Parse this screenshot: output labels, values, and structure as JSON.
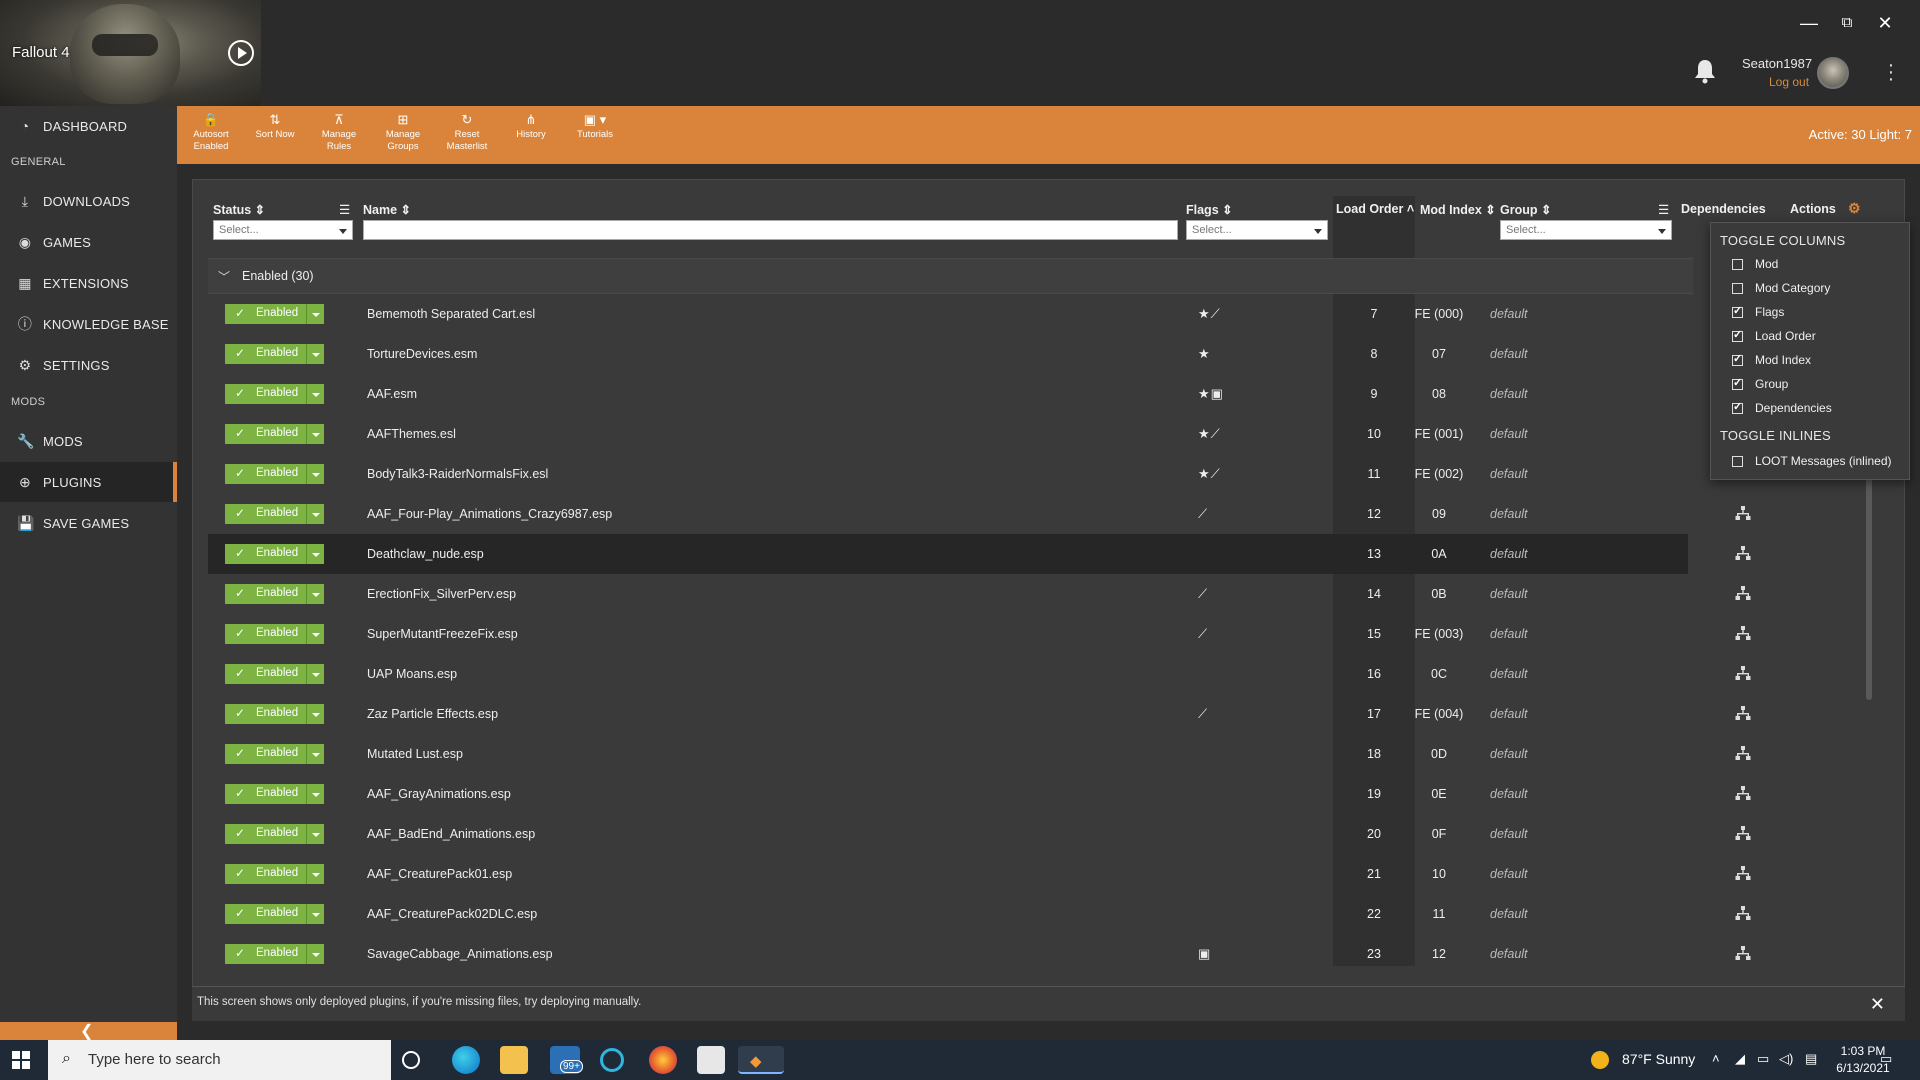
{
  "window": {
    "game_title": "Fallout 4",
    "user": {
      "name": "Seaton1987",
      "logout_label": "Log out"
    },
    "controls": {
      "minimize": "—",
      "restore": "⧉",
      "close": "✕"
    }
  },
  "sidebar": {
    "dashboard": "DASHBOARD",
    "general_head": "GENERAL",
    "general_items": [
      "DOWNLOADS",
      "GAMES",
      "EXTENSIONS",
      "KNOWLEDGE BASE",
      "SETTINGS"
    ],
    "mods_head": "MODS",
    "mods_items": [
      "MODS",
      "PLUGINS",
      "SAVE GAMES"
    ],
    "collapse_glyph": "❮"
  },
  "toolbar": {
    "buttons": [
      {
        "line1": "Autosort",
        "line2": "Enabled",
        "icon": "lock-icon"
      },
      {
        "line1": "Sort Now",
        "line2": "",
        "icon": "sort-icon"
      },
      {
        "line1": "Manage",
        "line2": "Rules",
        "icon": "rules-icon"
      },
      {
        "line1": "Manage",
        "line2": "Groups",
        "icon": "groups-icon"
      },
      {
        "line1": "Reset",
        "line2": "Masterlist",
        "icon": "refresh-icon"
      },
      {
        "line1": "History",
        "line2": "",
        "icon": "history-icon"
      },
      {
        "line1": "Tutorials",
        "line2": "",
        "icon": "tutorials-icon"
      }
    ],
    "active_count": "Active: 30 Light: 7"
  },
  "table": {
    "headers": {
      "status": "Status",
      "name": "Name",
      "flags": "Flags",
      "load_order": "Load Order",
      "mod_index": "Mod Index",
      "group": "Group",
      "dependencies": "Dependencies",
      "actions": "Actions"
    },
    "filters": {
      "status": "Select...",
      "flags": "Select...",
      "group": "Select..."
    },
    "group_label": "Enabled (30)",
    "status_label": "Enabled",
    "rows": [
      {
        "name": "Bememoth Separated Cart.esl",
        "flags": "★⟋",
        "lo": "7",
        "mi": "FE (000)",
        "group": "default"
      },
      {
        "name": "TortureDevices.esm",
        "flags": "★",
        "lo": "8",
        "mi": "07",
        "group": "default"
      },
      {
        "name": "AAF.esm",
        "flags": "★▣",
        "lo": "9",
        "mi": "08",
        "group": "default"
      },
      {
        "name": "AAFThemes.esl",
        "flags": "★⟋",
        "lo": "10",
        "mi": "FE (001)",
        "group": "default"
      },
      {
        "name": "BodyTalk3-RaiderNormalsFix.esl",
        "flags": "★⟋",
        "lo": "11",
        "mi": "FE (002)",
        "group": "default"
      },
      {
        "name": "AAF_Four-Play_Animations_Crazy6987.esp",
        "flags": "⟋",
        "lo": "12",
        "mi": "09",
        "group": "default"
      },
      {
        "name": "Deathclaw_nude.esp",
        "flags": "",
        "lo": "13",
        "mi": "0A",
        "group": "default"
      },
      {
        "name": "ErectionFix_SilverPerv.esp",
        "flags": "⟋",
        "lo": "14",
        "mi": "0B",
        "group": "default"
      },
      {
        "name": "SuperMutantFreezeFix.esp",
        "flags": "⟋",
        "lo": "15",
        "mi": "FE (003)",
        "group": "default"
      },
      {
        "name": "UAP Moans.esp",
        "flags": "",
        "lo": "16",
        "mi": "0C",
        "group": "default"
      },
      {
        "name": "Zaz Particle Effects.esp",
        "flags": "⟋",
        "lo": "17",
        "mi": "FE (004)",
        "group": "default"
      },
      {
        "name": "Mutated Lust.esp",
        "flags": "",
        "lo": "18",
        "mi": "0D",
        "group": "default"
      },
      {
        "name": "AAF_GrayAnimations.esp",
        "flags": "",
        "lo": "19",
        "mi": "0E",
        "group": "default"
      },
      {
        "name": "AAF_BadEnd_Animations.esp",
        "flags": "",
        "lo": "20",
        "mi": "0F",
        "group": "default"
      },
      {
        "name": "AAF_CreaturePack01.esp",
        "flags": "",
        "lo": "21",
        "mi": "10",
        "group": "default"
      },
      {
        "name": "AAF_CreaturePack02DLC.esp",
        "flags": "",
        "lo": "22",
        "mi": "11",
        "group": "default"
      },
      {
        "name": "SavageCabbage_Animations.esp",
        "flags": "▣",
        "lo": "23",
        "mi": "12",
        "group": "default"
      }
    ]
  },
  "toggle_popover": {
    "columns_head": "TOGGLE COLUMNS",
    "columns": [
      {
        "label": "Mod",
        "checked": false
      },
      {
        "label": "Mod Category",
        "checked": false
      },
      {
        "label": "Flags",
        "checked": true
      },
      {
        "label": "Load Order",
        "checked": true
      },
      {
        "label": "Mod Index",
        "checked": true
      },
      {
        "label": "Group",
        "checked": true
      },
      {
        "label": "Dependencies",
        "checked": true
      }
    ],
    "inlines_head": "TOGGLE INLINES",
    "inlines": [
      {
        "label": "LOOT Messages (inlined)",
        "checked": false
      }
    ]
  },
  "footer": {
    "text": "This screen shows only deployed plugins, if you're missing files, try deploying manually.",
    "close": "✕"
  },
  "taskbar": {
    "search_placeholder": "Type here to search",
    "weather": "87°F  Sunny",
    "time": "1:03 PM",
    "date": "6/13/2021",
    "mail_badge": "99+"
  },
  "colors": {
    "accent": "#d9843a",
    "enabled": "#7cb342",
    "panel": "#3a3a3a"
  }
}
